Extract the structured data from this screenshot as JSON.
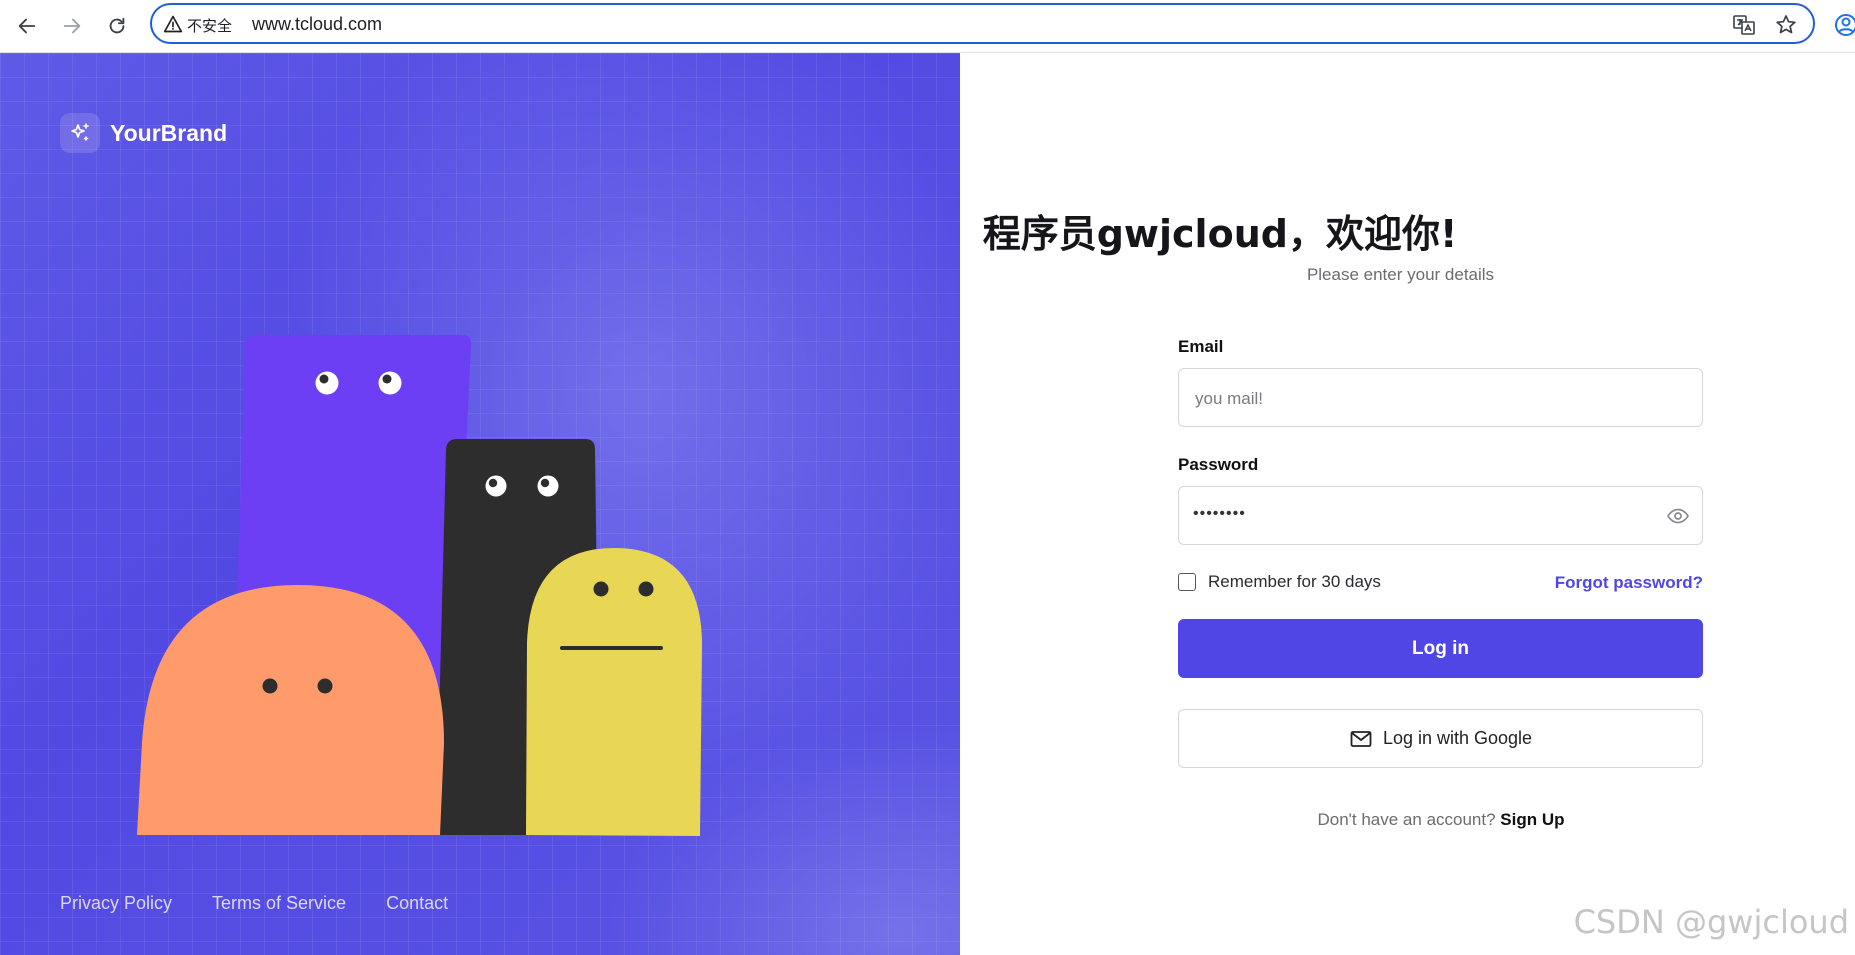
{
  "browser": {
    "security_label": "不安全",
    "url": "www.tcloud.com"
  },
  "brand": {
    "name": "YourBrand",
    "logo_icon": "sparkles-icon"
  },
  "footer": {
    "links": [
      "Privacy Policy",
      "Terms of Service",
      "Contact"
    ]
  },
  "login": {
    "title": "程序员gwjcloud，欢迎你!",
    "subtitle": "Please enter your details",
    "email_label": "Email",
    "email_placeholder": "you mail!",
    "password_label": "Password",
    "password_value": "••••••••",
    "remember_label": "Remember for 30 days",
    "forgot_label": "Forgot password?",
    "login_button": "Log in",
    "google_button": "Log in with Google",
    "no_account_text": "Don't have an account?",
    "signup_link": "Sign Up"
  },
  "watermark": "CSDN @gwjcloud",
  "colors": {
    "accent": "#4f46e5",
    "panel_bg": "#5249e3",
    "character_purple": "#6c3ff5",
    "character_black": "#2d2d2d",
    "character_orange": "#ff9b6b",
    "character_yellow": "#e8d754"
  }
}
